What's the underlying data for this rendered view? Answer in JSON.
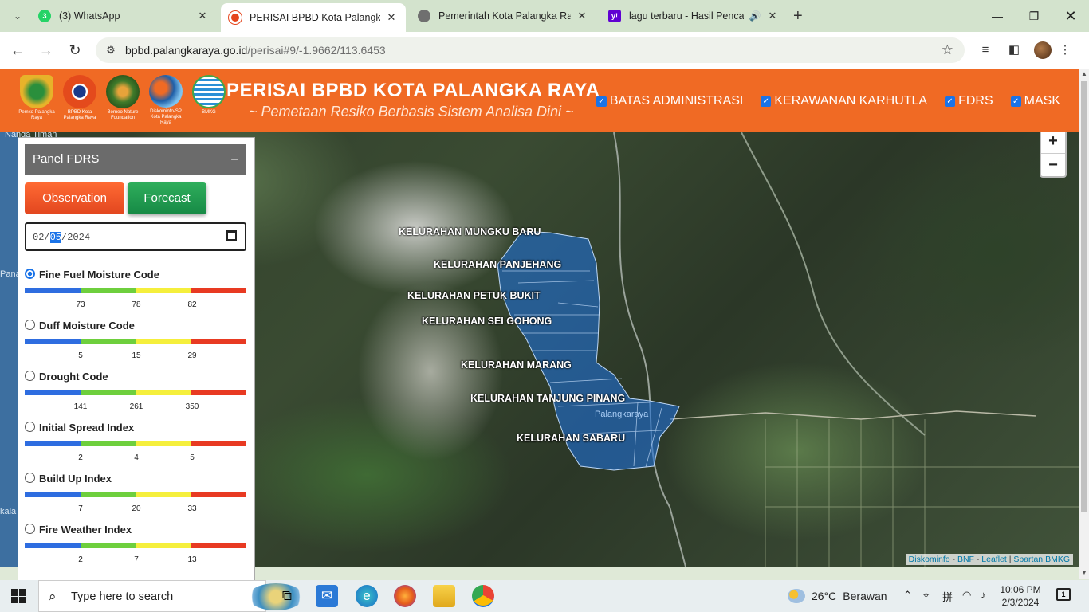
{
  "browser": {
    "tabs": [
      {
        "title": "(3) WhatsApp",
        "favicon_color": "#25d366",
        "favicon_text": "3",
        "active": false
      },
      {
        "title": "PERISAI BPBD Kota Palangka Ra",
        "favicon_color": "#e5451c",
        "favicon_text": "",
        "active": true
      },
      {
        "title": "Pemerintah Kota Palangka Raya",
        "favicon_color": "#6f6f6f",
        "favicon_text": "",
        "active": false
      },
      {
        "title": "lagu terbaru - Hasil Pencaria",
        "favicon_color": "#6001d2",
        "favicon_text": "y!",
        "active": false
      }
    ],
    "url_host": "bpbd.palangkaraya.go.id",
    "url_path": "/perisai#9/-1.9662/113.6453"
  },
  "header": {
    "title": "PERISAI BPBD KOTA PALANGKA RAYA",
    "subtitle": "~ Pemetaan Resiko Berbasis Sistem Analisa Dini ~",
    "logos": [
      {
        "caption": "Pemko Palangka Raya",
        "color": "#e7b32a"
      },
      {
        "caption": "BPBD Kota Palangka Raya",
        "color": "#e44a1c"
      },
      {
        "caption": "Borneo Nature Foundation",
        "color": "#3f7a2a"
      },
      {
        "caption": "Diskominfo-SP Kota Palangka Raya",
        "color": "#1f5fa8"
      },
      {
        "caption": "BMKG",
        "color": "#2a8fd6"
      }
    ],
    "layers": [
      {
        "label": "BATAS ADMINISTRASI",
        "checked": true
      },
      {
        "label": "KERAWANAN KARHUTLA",
        "checked": true
      },
      {
        "label": "FDRS",
        "checked": true
      },
      {
        "label": "MASK",
        "checked": true
      }
    ]
  },
  "map": {
    "zoom_in": "+",
    "zoom_out": "−",
    "edge_labels": [
      "Nanga Timan",
      "Pana",
      "kala"
    ],
    "kelurahan": [
      "KELURAHAN MUNGKU BARU",
      "KELURAHAN PANJEHANG",
      "KELURAHAN PETUK BUKIT",
      "KELURAHAN SEI GOHONG",
      "KELURAHAN MARANG",
      "KELURAHAN TANJUNG PINANG",
      "KELURAHAN SABARU"
    ],
    "city_label": "Palangkaraya",
    "attribution": [
      "Diskominfo",
      "BNF",
      "Leaflet",
      "Spartan BMKG"
    ]
  },
  "panel": {
    "title": "Panel FDRS",
    "collapse": "–",
    "observation_label": "Observation",
    "forecast_label": "Forecast",
    "date": {
      "day": "02",
      "month": "05",
      "year": "2024"
    },
    "indices": [
      {
        "name": "Fine Fuel Moisture Code",
        "selected": true,
        "ticks": [
          "73",
          "78",
          "82"
        ]
      },
      {
        "name": "Duff Moisture Code",
        "selected": false,
        "ticks": [
          "5",
          "15",
          "29"
        ]
      },
      {
        "name": "Drought Code",
        "selected": false,
        "ticks": [
          "141",
          "261",
          "350"
        ]
      },
      {
        "name": "Initial Spread Index",
        "selected": false,
        "ticks": [
          "2",
          "4",
          "5"
        ]
      },
      {
        "name": "Build Up Index",
        "selected": false,
        "ticks": [
          "7",
          "20",
          "33"
        ]
      },
      {
        "name": "Fire Weather Index",
        "selected": false,
        "ticks": [
          "2",
          "7",
          "13"
        ]
      }
    ],
    "scale_colors": [
      "#2e6de0",
      "#6ecf3d",
      "#f5ef3c",
      "#e83a22"
    ]
  },
  "taskbar": {
    "search_placeholder": "Type here to search",
    "weather_temp": "26°C",
    "weather_text": "Berawan",
    "time": "10:06 PM",
    "date": "2/3/2024",
    "notification_count": "1"
  }
}
